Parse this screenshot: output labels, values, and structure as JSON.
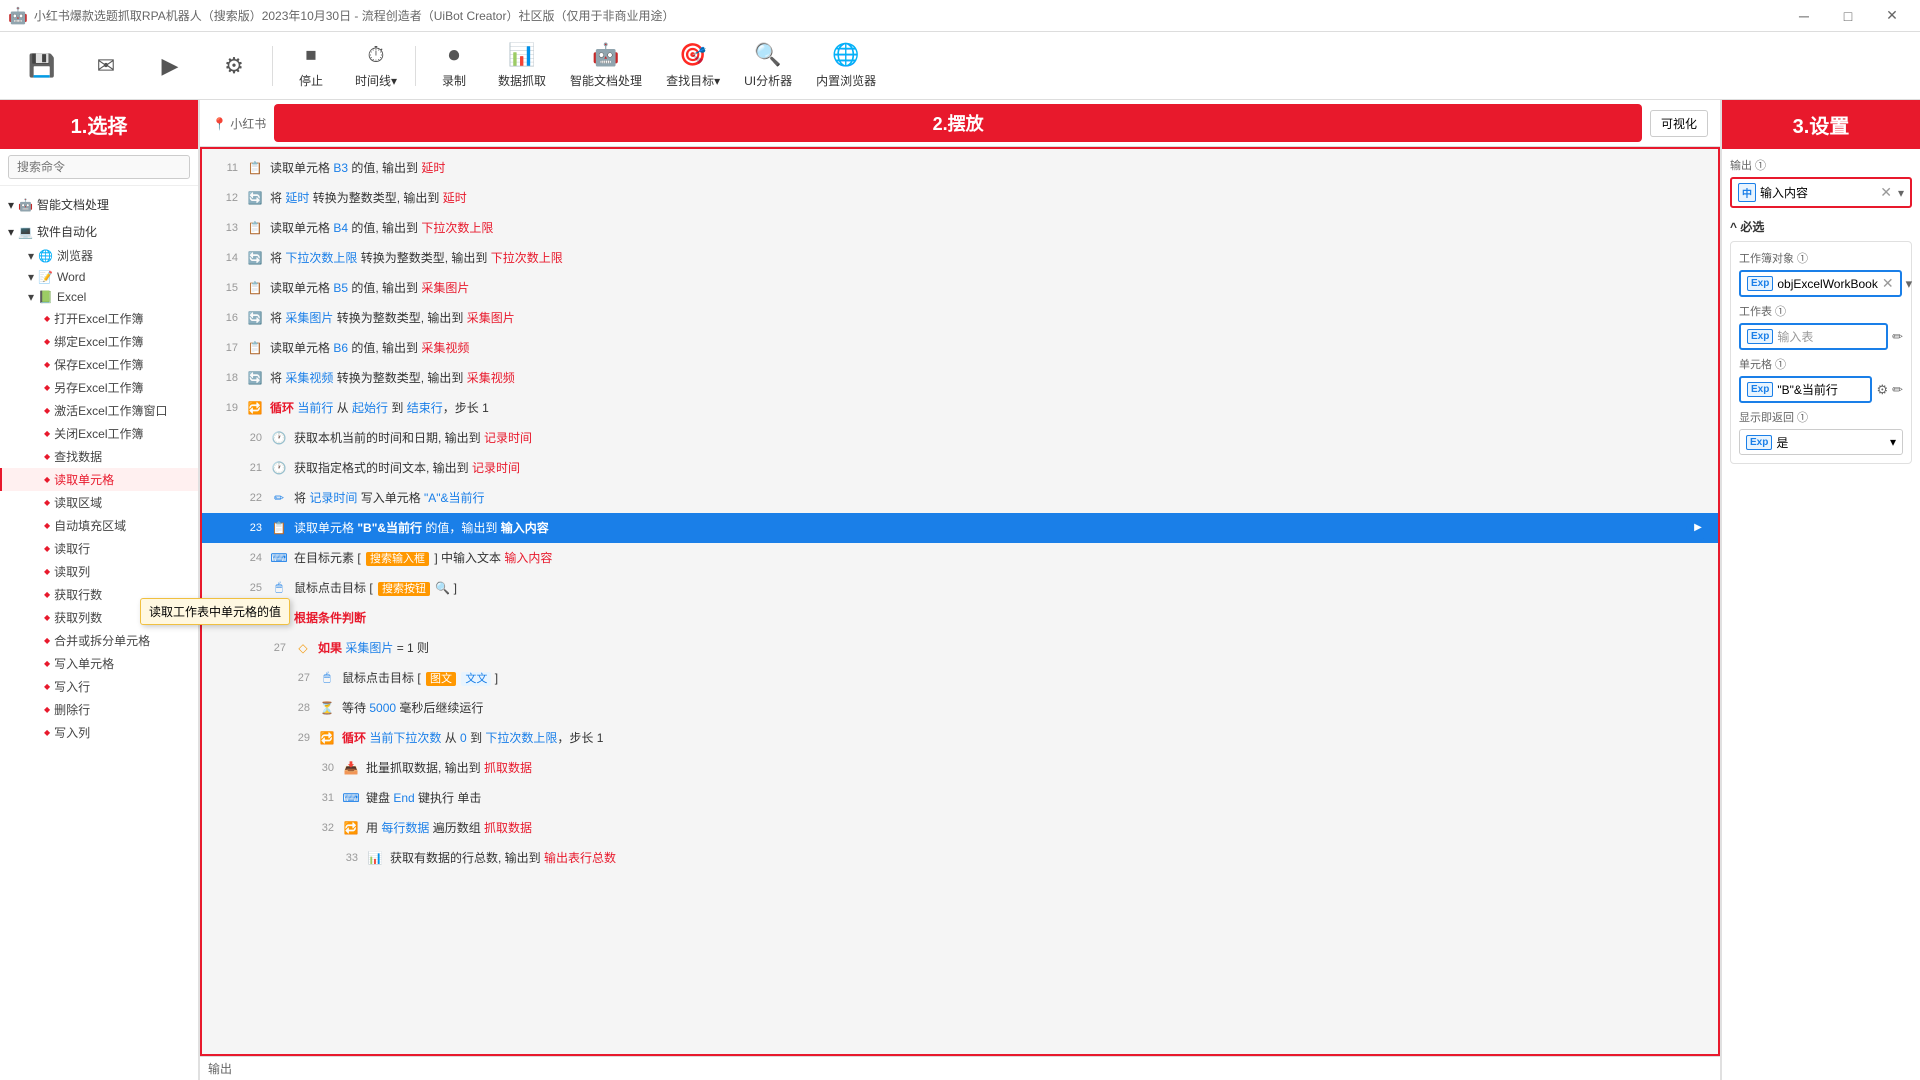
{
  "titleBar": {
    "title": "小红书爆款选题抓取RPA机器人（搜索版）2023年10月30日 - 流程创造者（UiBot Creator）社区版（仅用于非商业用途）",
    "controls": [
      "minimize",
      "maximize",
      "close"
    ]
  },
  "toolbar": {
    "items": [
      {
        "id": "stop",
        "icon": "⏹",
        "label": "停止"
      },
      {
        "id": "timeline",
        "icon": "⏱",
        "label": "时间线▾"
      },
      {
        "id": "record",
        "icon": "⏺",
        "label": "录制"
      },
      {
        "id": "data-extract",
        "icon": "📊",
        "label": "数据抓取"
      },
      {
        "id": "ai-process",
        "icon": "🤖",
        "label": "智能文档处理"
      },
      {
        "id": "find-target",
        "icon": "🎯",
        "label": "查找目标▾"
      },
      {
        "id": "ui-analyzer",
        "icon": "🔍",
        "label": "UI分析器"
      },
      {
        "id": "embedded-browser",
        "icon": "🌐",
        "label": "内置浏览器"
      }
    ]
  },
  "leftPanel": {
    "header": "1.选择",
    "searchPlaceholder": "搜索命令",
    "tree": [
      {
        "id": "ai-doc",
        "label": "智能文档处理",
        "expanded": true,
        "icon": "🤖",
        "children": []
      },
      {
        "id": "software-auto",
        "label": "软件自动化",
        "expanded": true,
        "icon": "💻",
        "children": [
          {
            "id": "browser",
            "label": "浏览器",
            "expanded": true
          },
          {
            "id": "word",
            "label": "Word",
            "expanded": false
          },
          {
            "id": "excel",
            "label": "Excel",
            "expanded": true,
            "children": [
              {
                "id": "open-excel",
                "label": "打开Excel工作簿"
              },
              {
                "id": "bind-excel",
                "label": "绑定Excel工作簿"
              },
              {
                "id": "save-excel",
                "label": "保存Excel工作簿"
              },
              {
                "id": "saveas-excel",
                "label": "另存Excel工作簿"
              },
              {
                "id": "active-excel",
                "label": "激活Excel工作簿窗口"
              },
              {
                "id": "close-excel",
                "label": "关闭Excel工作簿"
              },
              {
                "id": "find-data",
                "label": "查找数据"
              },
              {
                "id": "read-cell",
                "label": "读取单元格",
                "active": true
              },
              {
                "id": "read-area",
                "label": "读取区域"
              },
              {
                "id": "autofill-area",
                "label": "自动填充区域"
              },
              {
                "id": "read-row",
                "label": "读取行"
              },
              {
                "id": "read-col",
                "label": "读取列"
              },
              {
                "id": "get-rows",
                "label": "获取行数"
              },
              {
                "id": "get-cols",
                "label": "获取列数"
              },
              {
                "id": "merge-split",
                "label": "合并或拆分单元格"
              },
              {
                "id": "write-cell",
                "label": "写入单元格"
              },
              {
                "id": "write-row",
                "label": "写入行"
              },
              {
                "id": "delete-row",
                "label": "删除行"
              },
              {
                "id": "write-col",
                "label": "写入列"
              }
            ]
          }
        ]
      }
    ],
    "tooltip": "读取工作表中单元格的值"
  },
  "middlePanel": {
    "header": "2.摆放",
    "visibleBtn": "可视化",
    "rows": [
      {
        "num": 11,
        "icon": "read",
        "content": "读取单元格 B3 的值, 输出到 延时",
        "indentLevel": 0
      },
      {
        "num": 12,
        "icon": "convert",
        "content": "将 延时 转换为整数类型, 输出到 延时",
        "indentLevel": 0
      },
      {
        "num": 13,
        "icon": "read",
        "content": "读取单元格 B4 的值, 输出到 下拉次数上限",
        "indentLevel": 0
      },
      {
        "num": 14,
        "icon": "convert",
        "content": "将 下拉次数上限 转换为整数类型, 输出到 下拉次数上限",
        "indentLevel": 0
      },
      {
        "num": 15,
        "icon": "read",
        "content": "读取单元格 B5 的值, 输出到 采集图片",
        "indentLevel": 0
      },
      {
        "num": 16,
        "icon": "convert",
        "content": "将 采集图片 转换为整数类型, 输出到 采集图片",
        "indentLevel": 0
      },
      {
        "num": 17,
        "icon": "read",
        "content": "读取单元格 B6 的值, 输出到 采集视频",
        "indentLevel": 0
      },
      {
        "num": 18,
        "icon": "convert",
        "content": "将 采集视频 转换为整数类型, 输出到 采集视频",
        "indentLevel": 0
      },
      {
        "num": 19,
        "icon": "loop",
        "content": "循环 当前行 从 起始行 到 结束行，步长 1",
        "indentLevel": 0
      },
      {
        "num": 20,
        "icon": "time",
        "content": "获取本机当前的时间和日期, 输出到 记录时间",
        "indentLevel": 1
      },
      {
        "num": 21,
        "icon": "time",
        "content": "获取指定格式的时间文本, 输出到 记录时间",
        "indentLevel": 1
      },
      {
        "num": 22,
        "icon": "write",
        "content": "将 记录时间 写入单元格 \"A\"&当前行",
        "indentLevel": 1
      },
      {
        "num": 23,
        "icon": "read",
        "content": "读取单元格 \"B\"&当前行 的值，输出到 输入内容",
        "indentLevel": 1,
        "highlighted": true
      },
      {
        "num": 24,
        "icon": "input",
        "content": "在目标元素 [ 搜索输入框 ] 中输入文本 输入内容",
        "indentLevel": 1
      },
      {
        "num": 25,
        "icon": "mouse",
        "content": "鼠标点击目标 [ 搜索按钮 🔍 ]",
        "indentLevel": 1
      },
      {
        "num": 26,
        "icon": "condition",
        "content": "根据条件判断",
        "indentLevel": 1
      },
      {
        "num": 27,
        "icon": "if",
        "content": "如果 采集图片 = 1 则",
        "indentLevel": 2
      },
      {
        "num": 27,
        "icon": "mouse",
        "content": "鼠标点击目标 [ 图文 文文 ]",
        "indentLevel": 3
      },
      {
        "num": 28,
        "icon": "wait",
        "content": "等待 5000 毫秒后继续运行",
        "indentLevel": 3
      },
      {
        "num": 29,
        "icon": "loop",
        "content": "循环 当前下拉次数 从 0 到 下拉次数上限，步长 1",
        "indentLevel": 3
      },
      {
        "num": 30,
        "icon": "extract",
        "content": "批量抓取数据, 输出到 抓取数据",
        "indentLevel": 4
      },
      {
        "num": 31,
        "icon": "keyboard",
        "content": "键盘 End 键执行 单击",
        "indentLevel": 4
      },
      {
        "num": 32,
        "icon": "loop",
        "content": "用 每行数据 遍历数组 抓取数据",
        "indentLevel": 4
      },
      {
        "num": 33,
        "icon": "data",
        "content": "获取有数据的行总数, 输出到 输出表行总数",
        "indentLevel": 5
      }
    ],
    "bottomText": "输出"
  },
  "rightPanel": {
    "header": "3.设置",
    "outputLabel": "输出 ①",
    "outputValue": "输入内容",
    "requiredTitle": "^ 必选",
    "workbookLabel": "工作簿对象 ①",
    "workbookValue": "objExcelWorkBook",
    "worksheetLabel": "工作表 ①",
    "worksheetPlaceholder": "输入表",
    "cellLabel": "单元格 ①",
    "cellValue": "\"B\"&当前行",
    "returnLabel": "显示即返回 ①",
    "returnValue": "是"
  }
}
